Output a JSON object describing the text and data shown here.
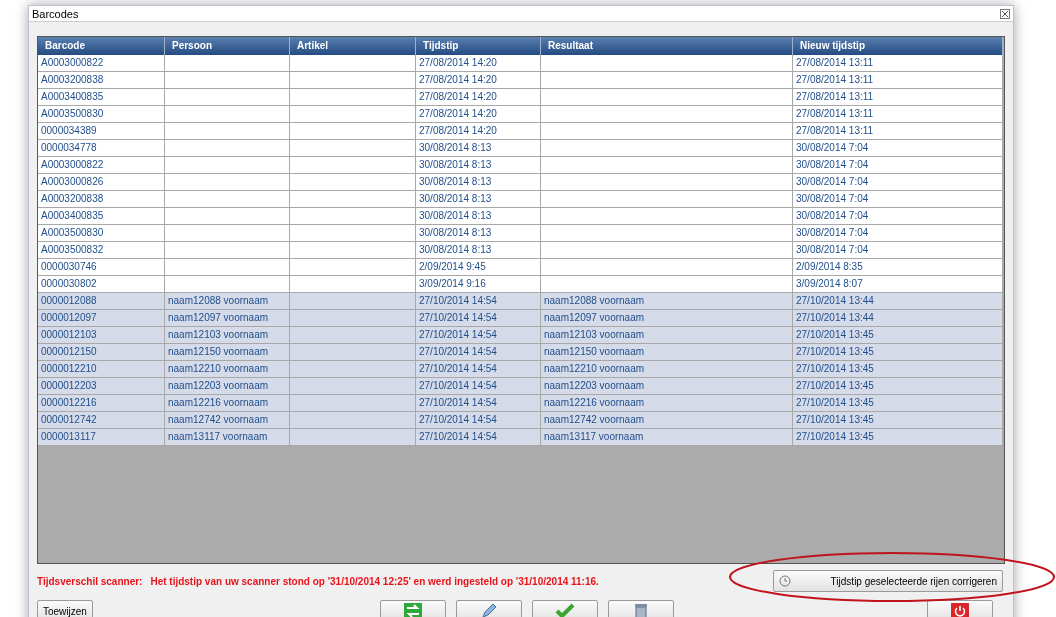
{
  "window": {
    "title": "Barcodes"
  },
  "table": {
    "columns": [
      "Barcode",
      "Persoon",
      "Artikel",
      "Tijdstip",
      "Resultaat",
      "Nieuw tijdstip"
    ],
    "rows": [
      {
        "cells": [
          "A0003000822",
          "",
          "",
          "27/08/2014 14:20",
          "",
          "27/08/2014 13:11"
        ],
        "selected": false
      },
      {
        "cells": [
          "A0003200838",
          "",
          "",
          "27/08/2014 14:20",
          "",
          "27/08/2014 13:11"
        ],
        "selected": false
      },
      {
        "cells": [
          "A0003400835",
          "",
          "",
          "27/08/2014 14:20",
          "",
          "27/08/2014 13:11"
        ],
        "selected": false
      },
      {
        "cells": [
          "A0003500830",
          "",
          "",
          "27/08/2014 14:20",
          "",
          "27/08/2014 13:11"
        ],
        "selected": false
      },
      {
        "cells": [
          "0000034389",
          "",
          "",
          "27/08/2014 14:20",
          "",
          "27/08/2014 13:11"
        ],
        "selected": false
      },
      {
        "cells": [
          "0000034778",
          "",
          "",
          "30/08/2014 8:13",
          "",
          "30/08/2014 7:04"
        ],
        "selected": false
      },
      {
        "cells": [
          "A0003000822",
          "",
          "",
          "30/08/2014 8:13",
          "",
          "30/08/2014 7:04"
        ],
        "selected": false
      },
      {
        "cells": [
          "A0003000826",
          "",
          "",
          "30/08/2014 8:13",
          "",
          "30/08/2014 7:04"
        ],
        "selected": false
      },
      {
        "cells": [
          "A0003200838",
          "",
          "",
          "30/08/2014 8:13",
          "",
          "30/08/2014 7:04"
        ],
        "selected": false
      },
      {
        "cells": [
          "A0003400835",
          "",
          "",
          "30/08/2014 8:13",
          "",
          "30/08/2014 7:04"
        ],
        "selected": false
      },
      {
        "cells": [
          "A0003500830",
          "",
          "",
          "30/08/2014 8:13",
          "",
          "30/08/2014 7:04"
        ],
        "selected": false
      },
      {
        "cells": [
          "A0003500832",
          "",
          "",
          "30/08/2014 8:13",
          "",
          "30/08/2014 7:04"
        ],
        "selected": false
      },
      {
        "cells": [
          "0000030746",
          "",
          "",
          "2/09/2014 9:45",
          "",
          "2/09/2014 8:35"
        ],
        "selected": false
      },
      {
        "cells": [
          "0000030802",
          "",
          "",
          "3/09/2014 9:16",
          "",
          "3/09/2014 8:07"
        ],
        "selected": false
      },
      {
        "cells": [
          "0000012088",
          "naam12088 voornaam",
          "",
          "27/10/2014 14:54",
          "naam12088 voornaam",
          "27/10/2014 13:44"
        ],
        "selected": true
      },
      {
        "cells": [
          "0000012097",
          "naam12097 voornaam",
          "",
          "27/10/2014 14:54",
          "naam12097 voornaam",
          "27/10/2014 13:44"
        ],
        "selected": true
      },
      {
        "cells": [
          "0000012103",
          "naam12103 voornaam",
          "",
          "27/10/2014 14:54",
          "naam12103 voornaam",
          "27/10/2014 13:45"
        ],
        "selected": true
      },
      {
        "cells": [
          "0000012150",
          "naam12150 voornaam",
          "",
          "27/10/2014 14:54",
          "naam12150 voornaam",
          "27/10/2014 13:45"
        ],
        "selected": true
      },
      {
        "cells": [
          "0000012210",
          "naam12210 voornaam",
          "",
          "27/10/2014 14:54",
          "naam12210 voornaam",
          "27/10/2014 13:45"
        ],
        "selected": true
      },
      {
        "cells": [
          "0000012203",
          "naam12203 voornaam",
          "",
          "27/10/2014 14:54",
          "naam12203 voornaam",
          "27/10/2014 13:45"
        ],
        "selected": true
      },
      {
        "cells": [
          "0000012216",
          "naam12216 voornaam",
          "",
          "27/10/2014 14:54",
          "naam12216 voornaam",
          "27/10/2014 13:45"
        ],
        "selected": true
      },
      {
        "cells": [
          "0000012742",
          "naam12742 voornaam",
          "",
          "27/10/2014 14:54",
          "naam12742 voornaam",
          "27/10/2014 13:45"
        ],
        "selected": true
      },
      {
        "cells": [
          "0000013117",
          "naam13117 voornaam",
          "",
          "27/10/2014 14:54",
          "naam13117 voornaam",
          "27/10/2014 13:45"
        ],
        "selected": true
      }
    ]
  },
  "message": {
    "label": "Tijdsverschil scanner:",
    "text": "Het tijdstip van uw scanner stond op '31/10/2014 12:25' en werd ingesteld op '31/10/2014 11:16."
  },
  "correct_button": {
    "label": "Tijdstip geselecteerde rijen corrigeren"
  },
  "assign_button": {
    "label": "Toewijzen"
  },
  "toolbar": [
    {
      "kind": "swap"
    },
    {
      "kind": "edit"
    },
    {
      "kind": "check"
    },
    {
      "kind": "delete"
    }
  ]
}
